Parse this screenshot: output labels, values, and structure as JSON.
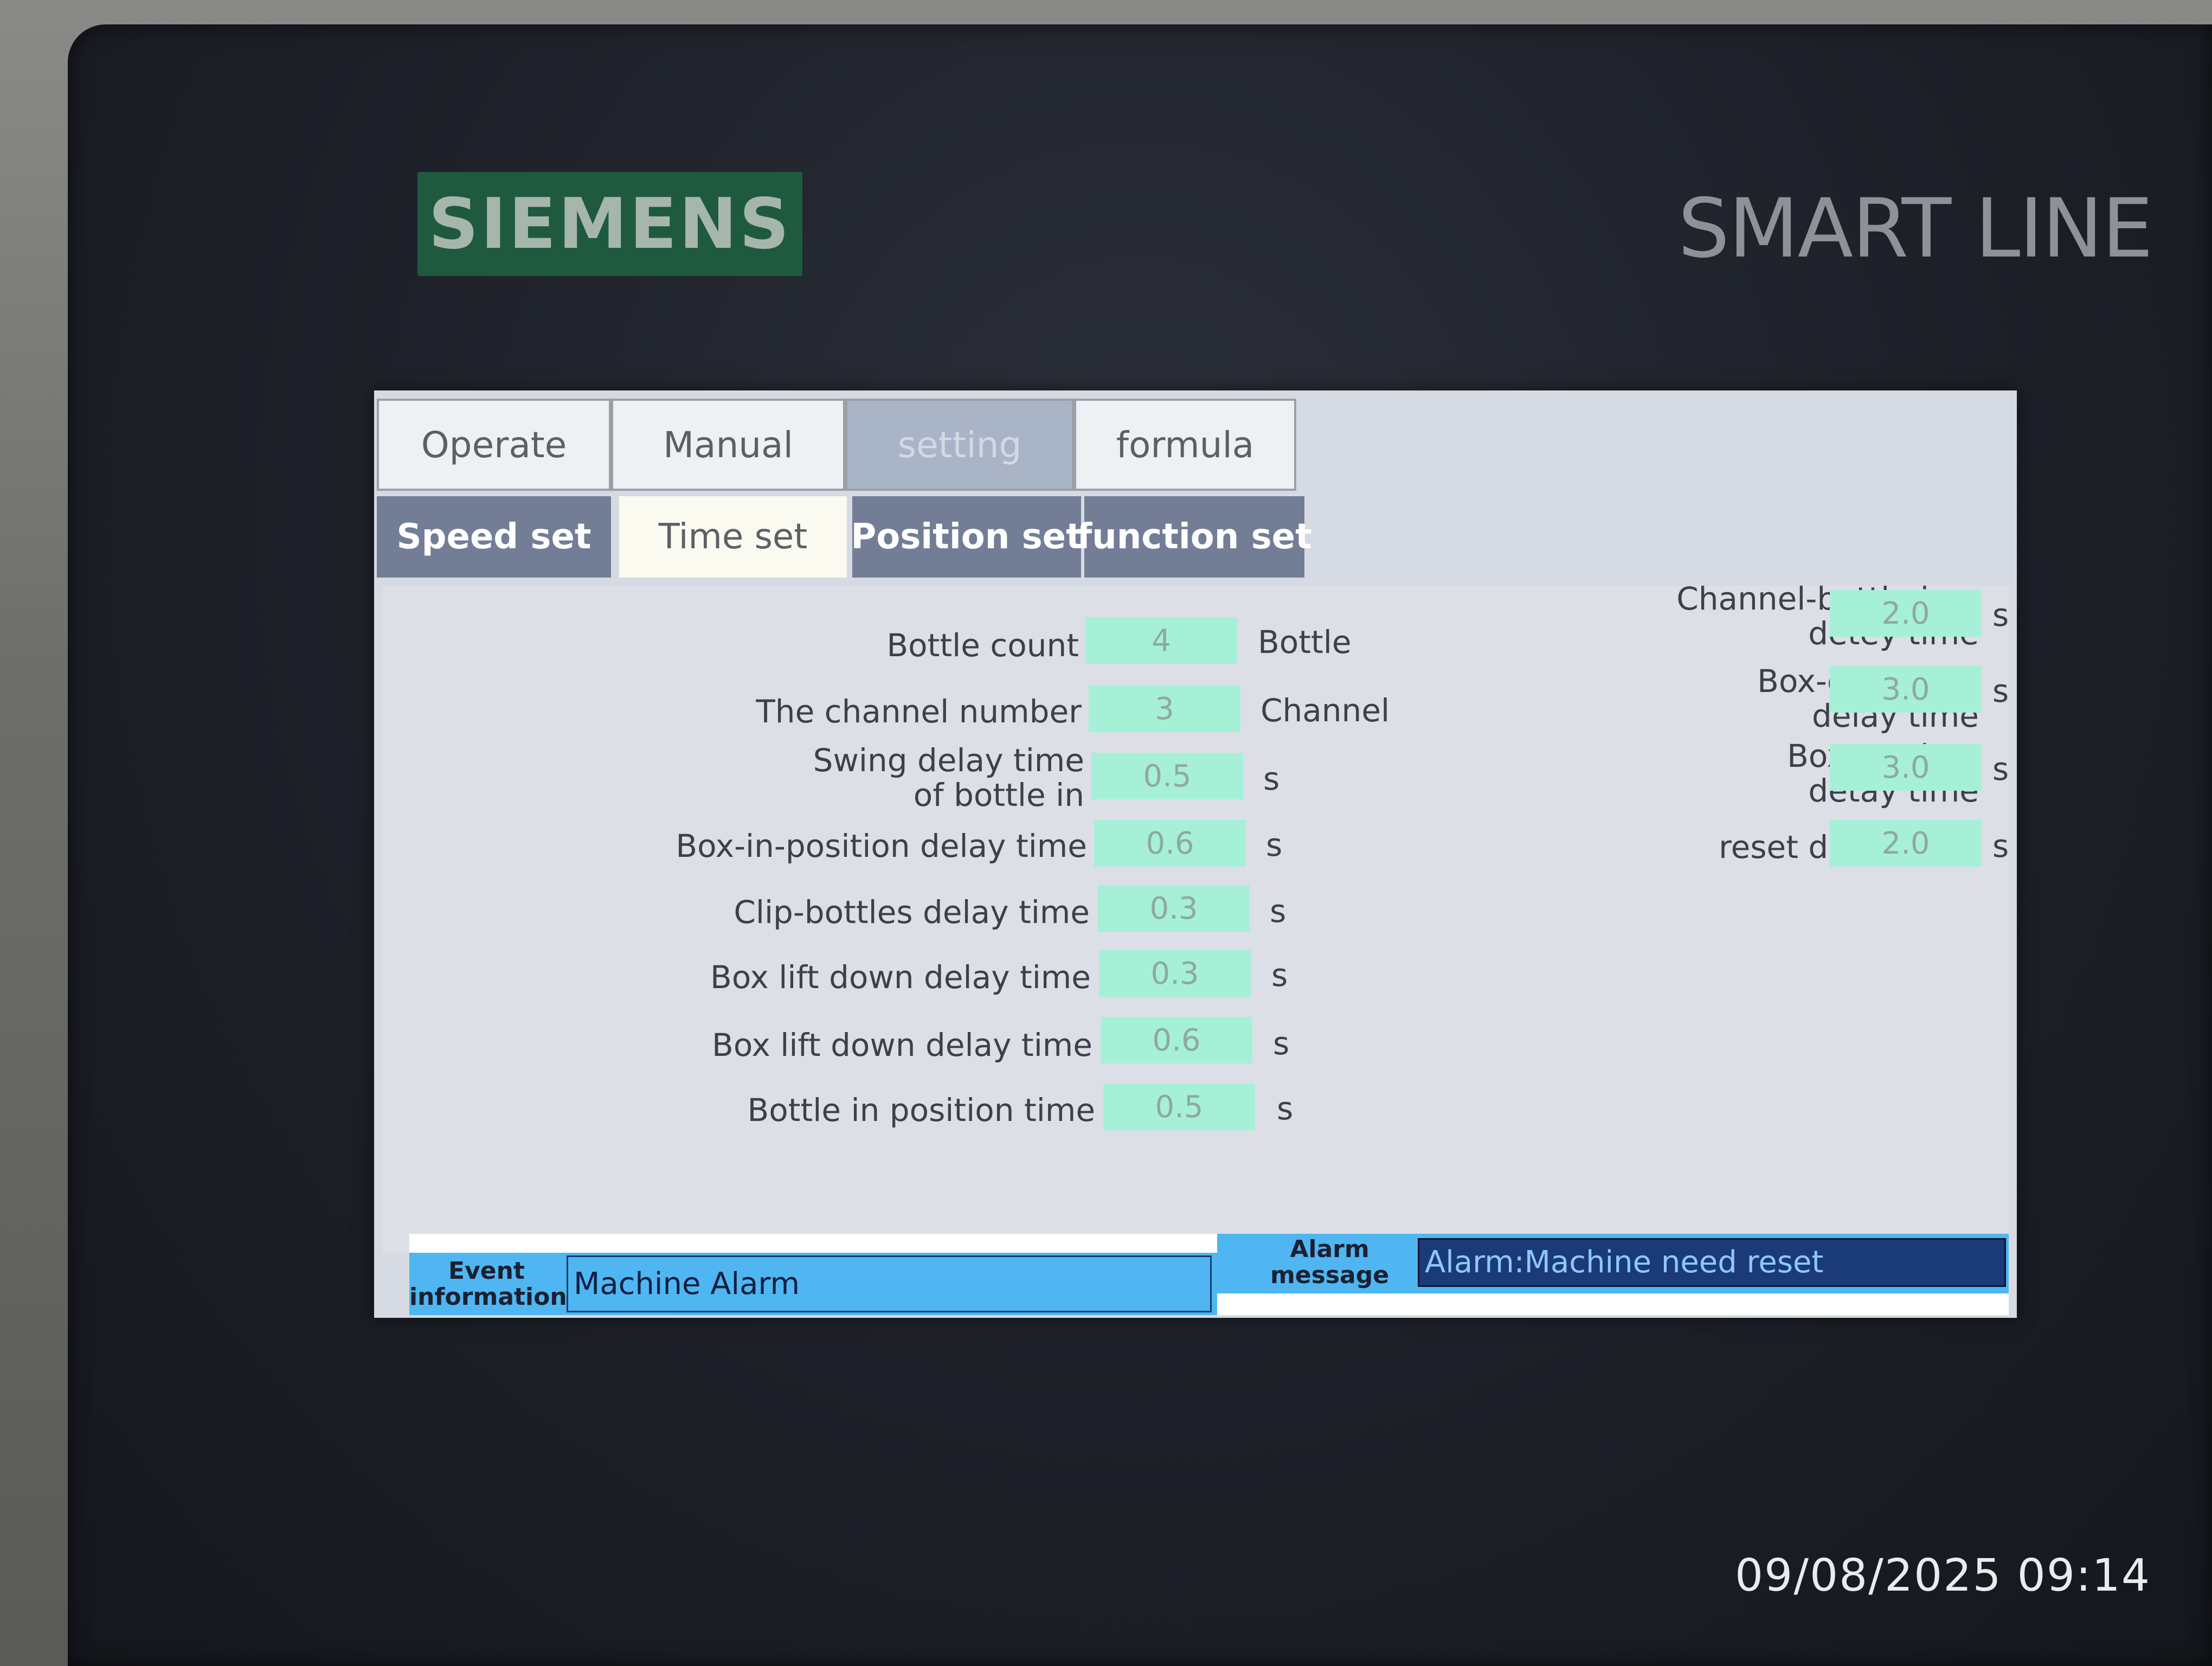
{
  "device": {
    "brand": "SIEMENS",
    "product_line": "SMART LINE",
    "colors": {
      "brand_green": "#1f5a3f",
      "field_green": "#a6f0d8",
      "subtab_active": "#737e96"
    }
  },
  "tabs": [
    {
      "label": "Operate",
      "active": false
    },
    {
      "label": "Manual",
      "active": false
    },
    {
      "label": "setting",
      "active": true
    },
    {
      "label": "formula",
      "active": false
    }
  ],
  "subtabs": [
    {
      "label": "Speed set"
    },
    {
      "label": "Time set"
    },
    {
      "label": "Position set"
    },
    {
      "label": "function  set"
    }
  ],
  "left_params": [
    {
      "label_line1": "Bottle count",
      "label_line2": "",
      "value": "4",
      "unit": "Bottle"
    },
    {
      "label_line1": "The channel number",
      "label_line2": "",
      "value": "3",
      "unit": "Channel"
    },
    {
      "label_line1": "Swing delay time",
      "label_line2": "of bottle in",
      "value": "0.5",
      "unit": "s"
    },
    {
      "label_line1": "Box-in-position delay time",
      "label_line2": "",
      "value": "0.6",
      "unit": "s"
    },
    {
      "label_line1": "Clip-bottles delay time",
      "label_line2": "",
      "value": "0.3",
      "unit": "s"
    },
    {
      "label_line1": "Box lift down delay time",
      "label_line2": "",
      "value": "0.3",
      "unit": "s"
    },
    {
      "label_line1": "Box lift down delay time",
      "label_line2": "",
      "value": "0.6",
      "unit": "s"
    },
    {
      "label_line1": "Bottle in position time",
      "label_line2": "",
      "value": "0.5",
      "unit": "s"
    }
  ],
  "right_params": [
    {
      "label_line1": "Channel-bottle-jam",
      "label_line2": "detey time",
      "value": "2.0",
      "unit": "s"
    },
    {
      "label_line1": "Box-enter-jam",
      "label_line2": "delay time",
      "value": "3.0",
      "unit": "s"
    },
    {
      "label_line1": "Box-out-jam",
      "label_line2": "detay time",
      "value": "3.0",
      "unit": "s"
    },
    {
      "label_line1": "reset detay time",
      "label_line2": "",
      "value": "2.0",
      "unit": "s"
    }
  ],
  "status_bar": {
    "event_label_line1": "Event",
    "event_label_line2": "information",
    "event_text": "Machine Alarm",
    "alarm_label_line1": "Alarm",
    "alarm_label_line2": "message",
    "alarm_text": "Alarm:Machine need reset"
  },
  "photo_timestamp": "09/08/2025 09:14"
}
